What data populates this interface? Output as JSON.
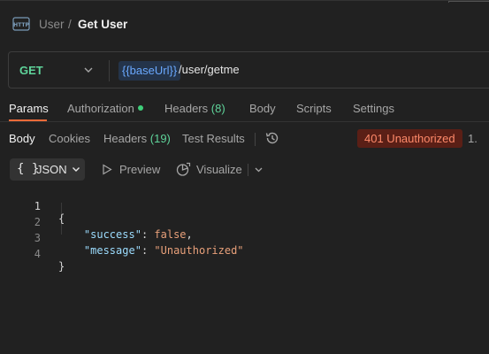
{
  "header": {
    "breadcrumb_parent": "User",
    "breadcrumb_separator": "/",
    "title": "Get User"
  },
  "request": {
    "method": "GET",
    "url_variable": "{{baseUrl}}",
    "url_path": "/user/getme"
  },
  "request_tabs": {
    "params": "Params",
    "authorization": "Authorization",
    "headers": "Headers",
    "headers_count": "(8)",
    "body": "Body",
    "scripts": "Scripts",
    "settings": "Settings"
  },
  "response_tabs": {
    "body": "Body",
    "cookies": "Cookies",
    "headers": "Headers",
    "headers_count": "(19)",
    "test_results": "Test Results"
  },
  "response_status": {
    "label": "401 Unauthorized",
    "time_fragment": "1."
  },
  "toolbar": {
    "format_icon": "{ }",
    "format_label": "JSON",
    "preview_label": "Preview",
    "visualize_label": "Visualize"
  },
  "code": {
    "line_numbers": [
      "1",
      "2",
      "3",
      "4"
    ],
    "open_brace": "{",
    "key_success": "\"success\"",
    "value_success": "false",
    "key_message": "\"message\"",
    "value_message": "\"Unauthorized\"",
    "colon": ": ",
    "comma": ",",
    "close_brace": "}"
  },
  "colors": {
    "background": "#212121",
    "method_get": "#5fd49a",
    "active_tab_underline": "#f06b38",
    "status_error_bg": "#5a1f16",
    "status_error_text": "#ff8a6a",
    "url_variable": "#6aa9ff"
  },
  "icons": {
    "app": "http-icon",
    "history": "history-icon",
    "preview": "play-icon",
    "visualize": "visualize-icon"
  }
}
